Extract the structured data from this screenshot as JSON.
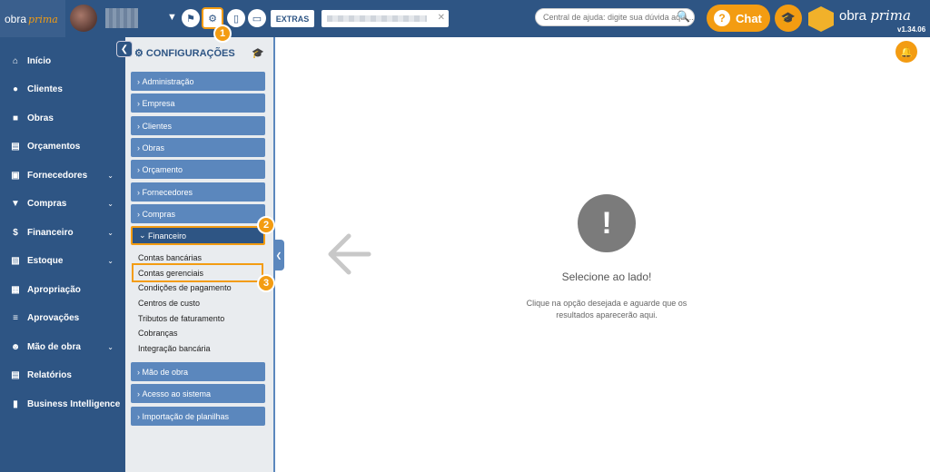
{
  "topbar": {
    "logo_main": "obra",
    "logo_accent": "prima",
    "extras_label": "EXTRAS",
    "help_placeholder": "Central de ajuda: digite sua dúvida aqui...",
    "chat_label": "Chat",
    "brand_name_main": "obra ",
    "brand_name_accent": "prima",
    "version": "v1.34.06"
  },
  "sidebar": {
    "items": [
      {
        "label": "Início",
        "icon": "home-icon"
      },
      {
        "label": "Clientes",
        "icon": "user-icon"
      },
      {
        "label": "Obras",
        "icon": "building-icon"
      },
      {
        "label": "Orçamentos",
        "icon": "document-icon"
      },
      {
        "label": "Fornecedores",
        "icon": "truck-icon"
      },
      {
        "label": "Compras",
        "icon": "cart-icon"
      },
      {
        "label": "Financeiro",
        "icon": "dollar-icon"
      },
      {
        "label": "Estoque",
        "icon": "archive-icon"
      },
      {
        "label": "Apropriação",
        "icon": "report-icon"
      },
      {
        "label": "Aprovações",
        "icon": "checklist-icon"
      },
      {
        "label": "Mão de obra",
        "icon": "workers-icon"
      },
      {
        "label": "Relatórios",
        "icon": "file-icon"
      },
      {
        "label": "Business Intelligence",
        "icon": "bar-chart-icon"
      }
    ]
  },
  "config": {
    "title": "CONFIGURAÇÕES",
    "categories": [
      "Administração",
      "Empresa",
      "Clientes",
      "Obras",
      "Orçamento",
      "Fornecedores",
      "Compras",
      "Financeiro"
    ],
    "financeiro_sub": [
      "Contas bancárias",
      "Contas gerenciais",
      "Condições de pagamento",
      "Centros de custo",
      "Tributos de faturamento",
      "Cobranças",
      "Integração bancária"
    ],
    "categories_after": [
      "Mão de obra",
      "Acesso ao sistema",
      "Importação de planilhas"
    ]
  },
  "badges": [
    "1",
    "2",
    "3"
  ],
  "main": {
    "empty_title": "Selecione ao lado!",
    "empty_desc": "Clique na opção desejada e aguarde que os resultados aparecerão aqui."
  },
  "colors": {
    "primary": "#2e5584",
    "accent": "#f39c12",
    "category": "#5b87bd"
  }
}
